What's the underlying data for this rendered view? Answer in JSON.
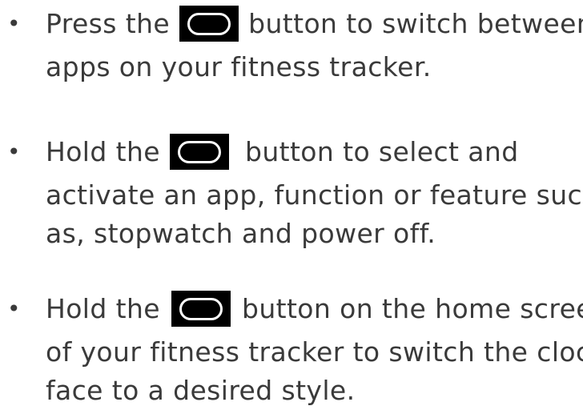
{
  "instructions": {
    "items": [
      {
        "bullet": "•",
        "lead": "Press the",
        "icon": "oval-button-icon",
        "line1_rest": "button to switch between",
        "lines": [
          "apps on your fitness tracker."
        ]
      },
      {
        "bullet": "•",
        "lead": "Hold the",
        "icon": "oval-button-icon",
        "line1_rest": "button to select and",
        "lines": [
          "activate an app, function or feature such",
          "as, stopwatch and power off."
        ]
      },
      {
        "bullet": "•",
        "lead": "Hold the",
        "icon": "oval-button-icon",
        "line1_rest": "button on the home screen",
        "lines": [
          "of your fitness tracker to switch the clock",
          "face to a desired style."
        ]
      }
    ]
  },
  "colors": {
    "text": "#3a3a3a",
    "button_icon_fill": "#000000",
    "button_icon_outline": "#ffffff"
  }
}
